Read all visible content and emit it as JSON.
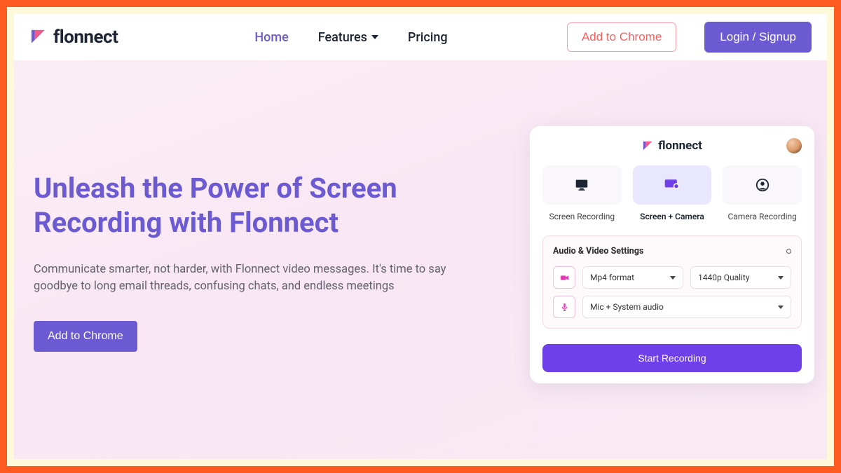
{
  "brand": "flonnect",
  "header": {
    "nav_home": "Home",
    "nav_features": "Features",
    "nav_pricing": "Pricing",
    "cta_chrome": "Add to Chrome",
    "cta_login": "Login / Signup"
  },
  "hero": {
    "title": "Unleash the Power of Screen Recording with Flonnect",
    "subtitle": "Communicate smarter, not harder, with Flonnect video messages. It's time to say goodbye to long email threads, confusing chats, and endless meetings",
    "cta": "Add to Chrome"
  },
  "panel": {
    "modes": {
      "screen": "Screen Recording",
      "screen_camera": "Screen + Camera",
      "camera": "Camera Recording"
    },
    "settings_title": "Audio & Video Settings",
    "format_select": "Mp4 format",
    "quality_select": "1440p Quality",
    "audio_select": "Mic + System audio",
    "start": "Start Recording"
  },
  "colors": {
    "accent": "#6b5ad1",
    "cta_outline": "#fc5d5d",
    "start_btn": "#6f40ea",
    "frame": "#ff5a1f"
  }
}
